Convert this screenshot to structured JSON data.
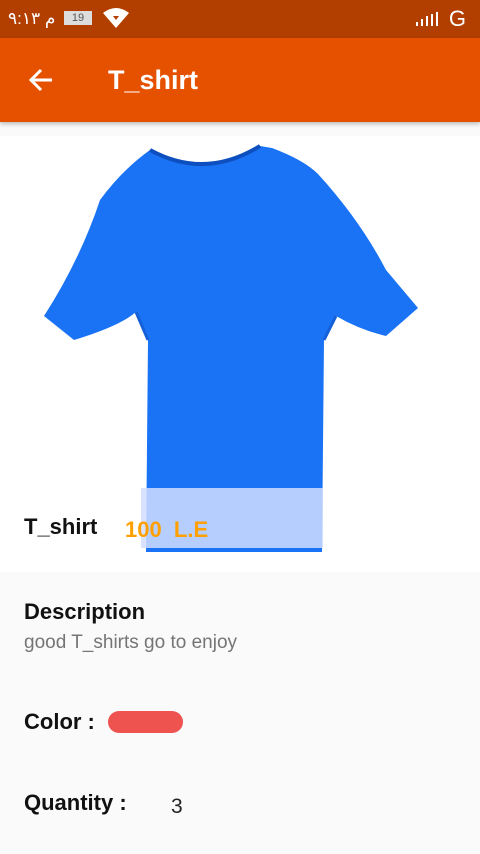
{
  "status_bar": {
    "time": "م ٩:١٣",
    "battery": "19",
    "network": "G",
    "colors": {
      "background": "#b23e00"
    }
  },
  "app_bar": {
    "title": "T_shirt",
    "back_icon": "arrow-left-icon",
    "colors": {
      "background": "#e65100"
    }
  },
  "product": {
    "image_icon": "t-shirt-image",
    "name": "T_shirt",
    "price": "100  L.E",
    "colors": {
      "price": "#ffa000",
      "shirt": "#1a73f5"
    }
  },
  "details": {
    "description_heading": "Description",
    "description_text": "good T_shirts go to enjoy",
    "color_label": "Color  :",
    "color_value": "#ef5350",
    "quantity_label": "Quantity  :",
    "quantity_value": "3"
  }
}
